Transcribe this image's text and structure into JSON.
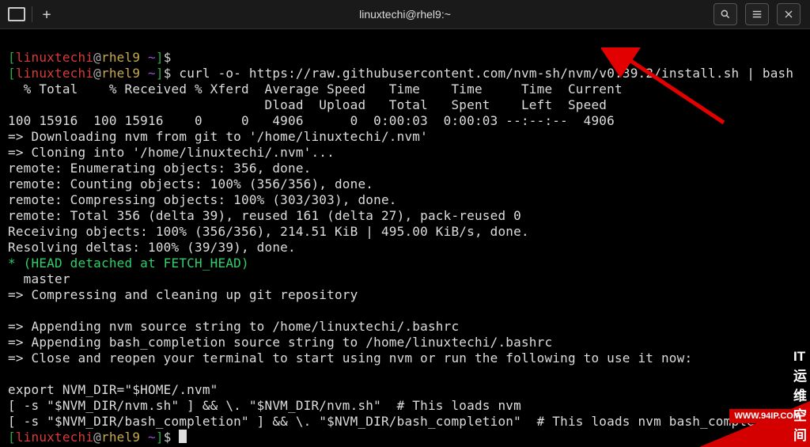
{
  "window": {
    "title": "linuxtechi@rhel9:~",
    "buttons": {
      "search": "search",
      "menu": "menu",
      "close": "close"
    }
  },
  "prompt": {
    "user": "linuxtechi",
    "host": "rhel9",
    "path": "~"
  },
  "command": "curl -o- https://raw.githubusercontent.com/nvm-sh/nvm/v0.39.2/install.sh | bash",
  "lines": {
    "h1": "  % Total    % Received % Xferd  Average Speed   Time    Time     Time  Current",
    "h2": "                                 Dload  Upload   Total   Spent    Left  Speed",
    "h3": "100 15916  100 15916    0     0   4906      0  0:00:03  0:00:03 --:--:--  4906",
    "l1": "=> Downloading nvm from git to '/home/linuxtechi/.nvm'",
    "l2": "=> Cloning into '/home/linuxtechi/.nvm'...",
    "l3": "remote: Enumerating objects: 356, done.",
    "l4": "remote: Counting objects: 100% (356/356), done.",
    "l5": "remote: Compressing objects: 100% (303/303), done.",
    "l6": "remote: Total 356 (delta 39), reused 161 (delta 27), pack-reused 0",
    "l7": "Receiving objects: 100% (356/356), 214.51 KiB | 495.00 KiB/s, done.",
    "l8": "Resolving deltas: 100% (39/39), done.",
    "l9": "(HEAD detached at FETCH_HEAD)",
    "l10": "  master",
    "l11": "=> Compressing and cleaning up git repository",
    "blank1": "",
    "l12": "=> Appending nvm source string to /home/linuxtechi/.bashrc",
    "l13": "=> Appending bash_completion source string to /home/linuxtechi/.bashrc",
    "l14": "=> Close and reopen your terminal to start using nvm or run the following to use it now:",
    "blank2": "",
    "l15": "export NVM_DIR=\"$HOME/.nvm\"",
    "l16": "[ -s \"$NVM_DIR/nvm.sh\" ] && \\. \"$NVM_DIR/nvm.sh\"  # This loads nvm",
    "l17": "[ -s \"$NVM_DIR/bash_completion\" ] && \\. \"$NVM_DIR/bash_completion\"  # This loads nvm bash_completion"
  },
  "watermark": {
    "url": "WWW.94IP.COM",
    "text": "IT运维空间"
  }
}
